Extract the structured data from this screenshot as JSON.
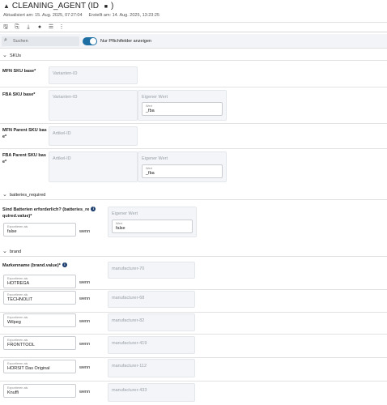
{
  "header": {
    "title": "CLEANING_AGENT (ID ",
    "title_tail": ")",
    "updated": "Aktualisiert am: 15. Aug. 2025, 07:27:04",
    "created": "Erstellt am: 14. Aug. 2025, 13:23:25"
  },
  "toolbar": {
    "icons": [
      "save-icon",
      "copy-icon",
      "download-icon",
      "status-icon",
      "filter-icon",
      "more-icon"
    ]
  },
  "filter": {
    "search_placeholder": "Suchen",
    "toggle_on": true,
    "toggle_label": "Nur Pflichtfelder anzeigen"
  },
  "sections": {
    "skus": "SKUs",
    "batteries": "batteries_required",
    "brand": "brand"
  },
  "skus": {
    "mfn_label": "MFN SKU base*",
    "mfn_placeholder": "Varianten-ID",
    "fba_label": "FBA SKU base*",
    "fba_placeholder": "Varianten-ID",
    "fba_own_title": "Eigener Wert",
    "fba_own_sub": "Wert",
    "fba_own_value": "_fba",
    "mfn_parent_label_1": "MFN Parent SKU bas",
    "mfn_parent_label_2": "e*",
    "mfn_parent_placeholder": "Artikel-ID",
    "fba_parent_label_1": "FBA Parent SKU bas",
    "fba_parent_label_2": "e*",
    "fba_parent_placeholder": "Artikel-ID",
    "fba_parent_own_title": "Eigener Wert",
    "fba_parent_own_sub": "Wert",
    "fba_parent_own_value": "_fba"
  },
  "batteries": {
    "label_1": "Sind Batterien erforderlich? (batteries_re",
    "label_2": "quired.value)*",
    "export_sub": "Exportieren als",
    "export_value": "false",
    "wenn": "wenn",
    "own_title": "Eigener Wert",
    "own_sub": "Wert",
    "own_value": "false"
  },
  "brand": {
    "label": "Markenname (brand.value)*",
    "export_sub": "Exportieren als",
    "wenn": "wenn",
    "rows": [
      {
        "value": "HOTREGA",
        "condition": "manufacturer-70"
      },
      {
        "value": "TECHNOLIT",
        "condition": "manufacturer-68"
      },
      {
        "value": "Wilpeg",
        "condition": "manufacturer-82"
      },
      {
        "value": "FRONTTOOL",
        "condition": "manufacturer-419"
      },
      {
        "value": "HORSIT Das Original",
        "condition": "manufacturer-112"
      },
      {
        "value": "Knuffi",
        "condition": "manufacturer-433"
      }
    ]
  }
}
